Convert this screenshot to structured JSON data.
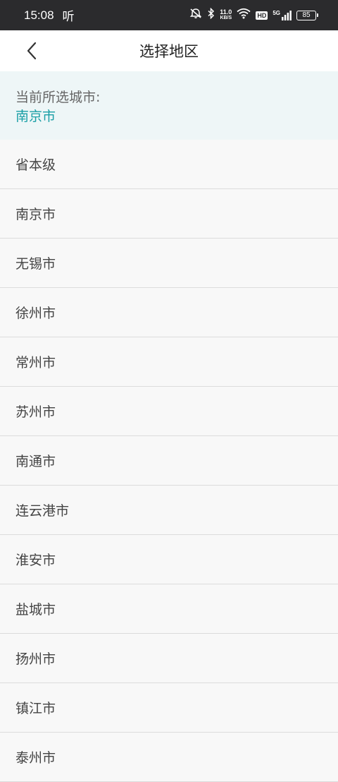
{
  "status_bar": {
    "time": "15:08",
    "notification_glyph": "听",
    "speed_value": "11.0",
    "speed_unit": "KB/S",
    "hd": "HD",
    "network": "5G",
    "battery": "85",
    "icons": [
      "mute-icon",
      "bluetooth-icon",
      "wifi-icon",
      "signal-icon",
      "battery-icon"
    ]
  },
  "header": {
    "title": "选择地区",
    "back_icon": "chevron-left-icon"
  },
  "current": {
    "label": "当前所选城市:",
    "value": "南京市",
    "accent_color": "#1a9fa6"
  },
  "cities": [
    "省本级",
    "南京市",
    "无锡市",
    "徐州市",
    "常州市",
    "苏州市",
    "南通市",
    "连云港市",
    "淮安市",
    "盐城市",
    "扬州市",
    "镇江市",
    "泰州市"
  ]
}
